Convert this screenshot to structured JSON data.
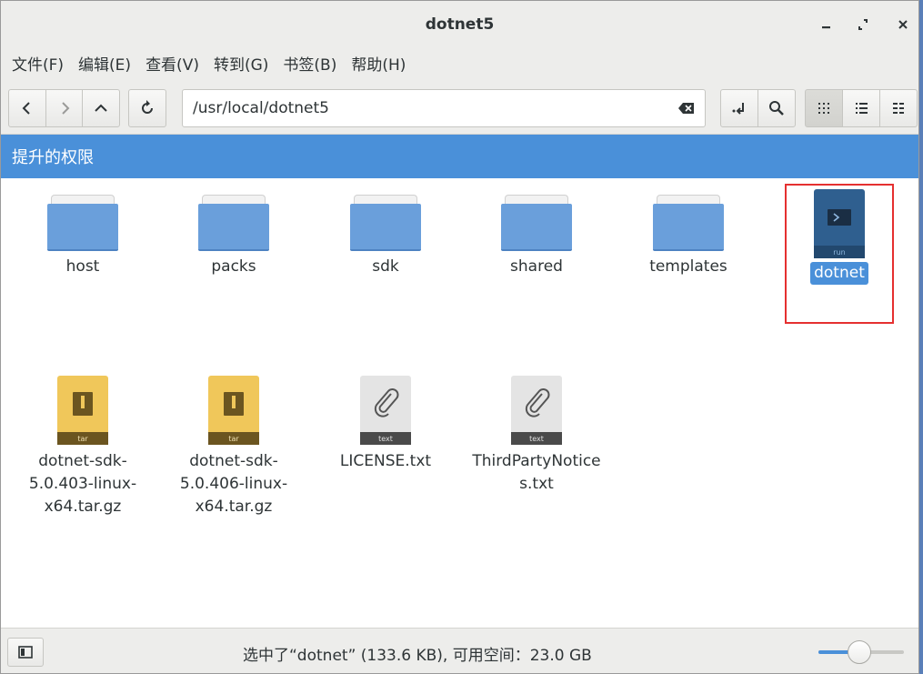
{
  "window": {
    "title": "dotnet5"
  },
  "menu": {
    "items": [
      "文件(F)",
      "编辑(E)",
      "查看(V)",
      "转到(G)",
      "书签(B)",
      "帮助(H)"
    ]
  },
  "location": {
    "path": "/usr/local/dotnet5"
  },
  "infobar": {
    "text": "提升的权限"
  },
  "files": [
    {
      "name": "host",
      "type": "folder"
    },
    {
      "name": "packs",
      "type": "folder"
    },
    {
      "name": "sdk",
      "type": "folder"
    },
    {
      "name": "shared",
      "type": "folder"
    },
    {
      "name": "templates",
      "type": "folder"
    },
    {
      "name": "dotnet",
      "type": "executable",
      "badge": "run",
      "selected": true
    },
    {
      "name_lines": [
        "dotnet-sdk-",
        "5.0.403-linux-",
        "x64.tar.gz"
      ],
      "type": "archive",
      "badge": "tar"
    },
    {
      "name_lines": [
        "dotnet-sdk-",
        "5.0.406-linux-",
        "x64.tar.gz"
      ],
      "type": "archive",
      "badge": "tar"
    },
    {
      "name": "LICENSE.txt",
      "type": "text",
      "badge": "text"
    },
    {
      "name_lines": [
        "ThirdPartyNotice",
        "s.txt"
      ],
      "type": "text",
      "badge": "text"
    }
  ],
  "status": {
    "text": "选中了“dotnet” (133.6 KB), 可用空间：23.0 GB"
  },
  "zoom": {
    "level_fraction": 0.48
  },
  "colors": {
    "accent": "#4a90d9",
    "highlight_box": "#e53030",
    "folder": "#6a9fdb",
    "archive": "#f0c75a"
  }
}
